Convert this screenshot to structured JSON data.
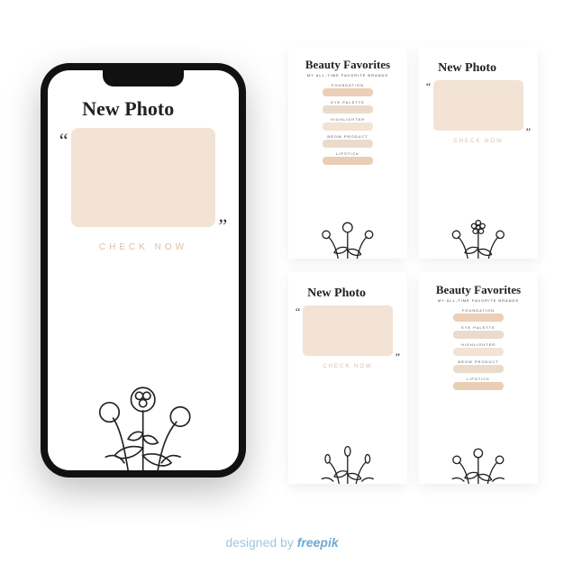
{
  "phone_template": {
    "title": "New Photo",
    "cta": "CHECK NOW"
  },
  "cards": {
    "new_photo": {
      "title": "New Photo",
      "cta": "CHECK NOW"
    },
    "beauty": {
      "title": "Beauty Favorites",
      "subtitle": "MY ALL-TIME FAVORITE BRANDS",
      "items": [
        {
          "label": "FOUNDATION",
          "color": "#eccfb6"
        },
        {
          "label": "EYE PALETTE",
          "color": "#eadbcb"
        },
        {
          "label": "HIGHLIGHTER",
          "color": "#f2e3d4"
        },
        {
          "label": "BROW PRODUCT",
          "color": "#eadbcb"
        },
        {
          "label": "LIPSTICK",
          "color": "#eacdb5"
        }
      ]
    }
  },
  "attribution": {
    "prefix": "designed by ",
    "brand": "freepik"
  },
  "colors": {
    "photo_box": "#f2e3d4",
    "cta": "#d9bfa4",
    "attribution": "#9fc7e0"
  }
}
